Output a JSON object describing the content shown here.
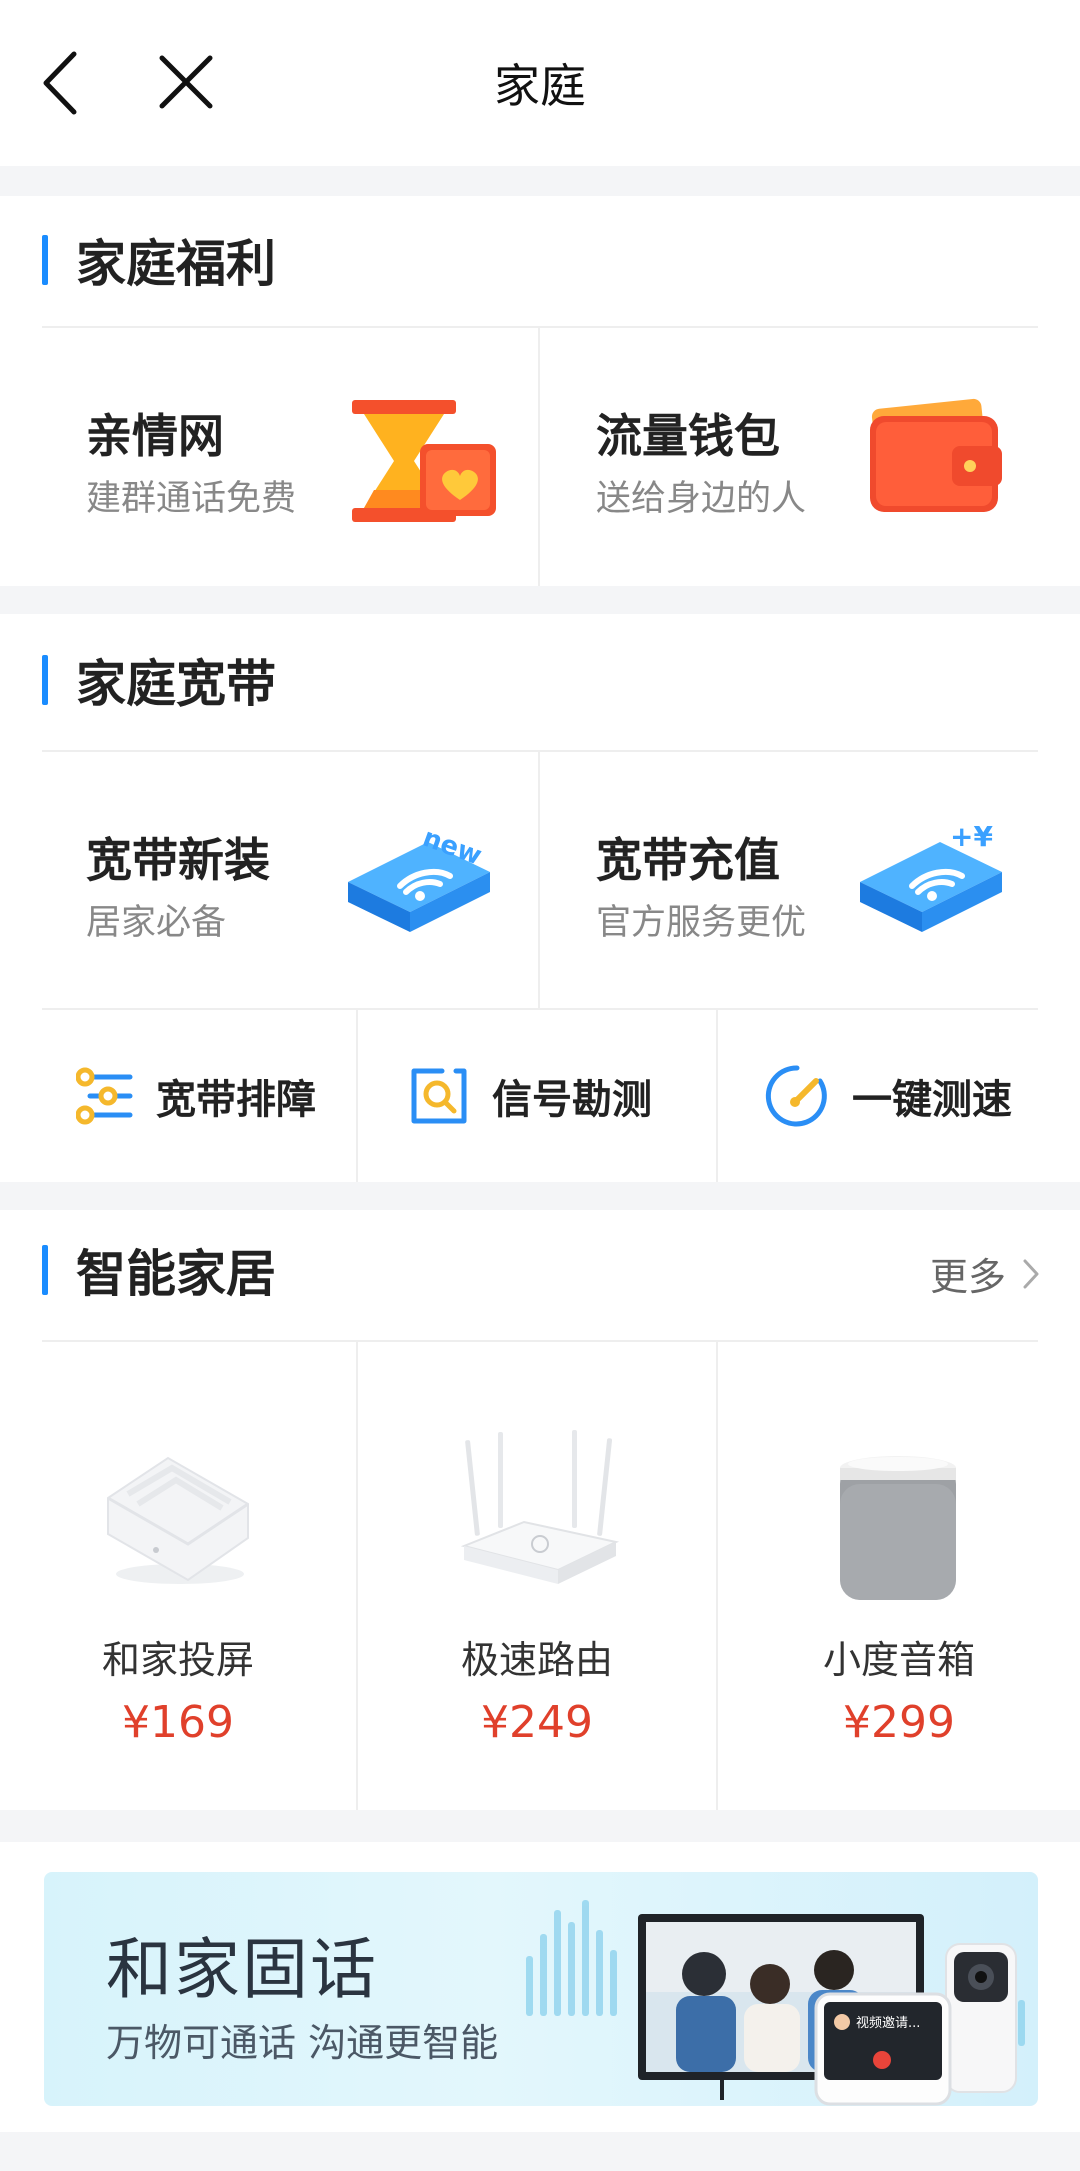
{
  "header": {
    "title": "家庭"
  },
  "welfare": {
    "title": "家庭福利",
    "tiles": [
      {
        "title": "亲情网",
        "subtitle": "建群通话免费",
        "icon": "hourglass-icon"
      },
      {
        "title": "流量钱包",
        "subtitle": "送给身边的人",
        "icon": "wallet-icon"
      }
    ]
  },
  "broadband": {
    "title": "家庭宽带",
    "tiles": [
      {
        "title": "宽带新装",
        "subtitle": "居家必备",
        "icon": "router-new-icon",
        "badge": "new"
      },
      {
        "title": "宽带充值",
        "subtitle": "官方服务更优",
        "icon": "router-recharge-icon",
        "badge": "+¥"
      }
    ],
    "tools": [
      {
        "label": "宽带排障",
        "icon": "sliders-icon"
      },
      {
        "label": "信号勘测",
        "icon": "signal-search-icon"
      },
      {
        "label": "一键测速",
        "icon": "speed-gauge-icon"
      }
    ]
  },
  "smarthome": {
    "title": "智能家居",
    "more_label": "更多",
    "products": [
      {
        "name": "和家投屏",
        "price": "¥169",
        "icon": "screen-cast-box-icon"
      },
      {
        "name": "极速路由",
        "price": "¥249",
        "icon": "wifi-router-icon"
      },
      {
        "name": "小度音箱",
        "price": "¥299",
        "icon": "smart-speaker-icon"
      }
    ]
  },
  "banner": {
    "title": "和家固话",
    "subtitle": "万物可通话   沟通更智能",
    "screen_text": "视频邀请..."
  },
  "colors": {
    "accent": "#1a8cff",
    "price": "#e0402b",
    "banner_bg": "#d7f3fb"
  }
}
